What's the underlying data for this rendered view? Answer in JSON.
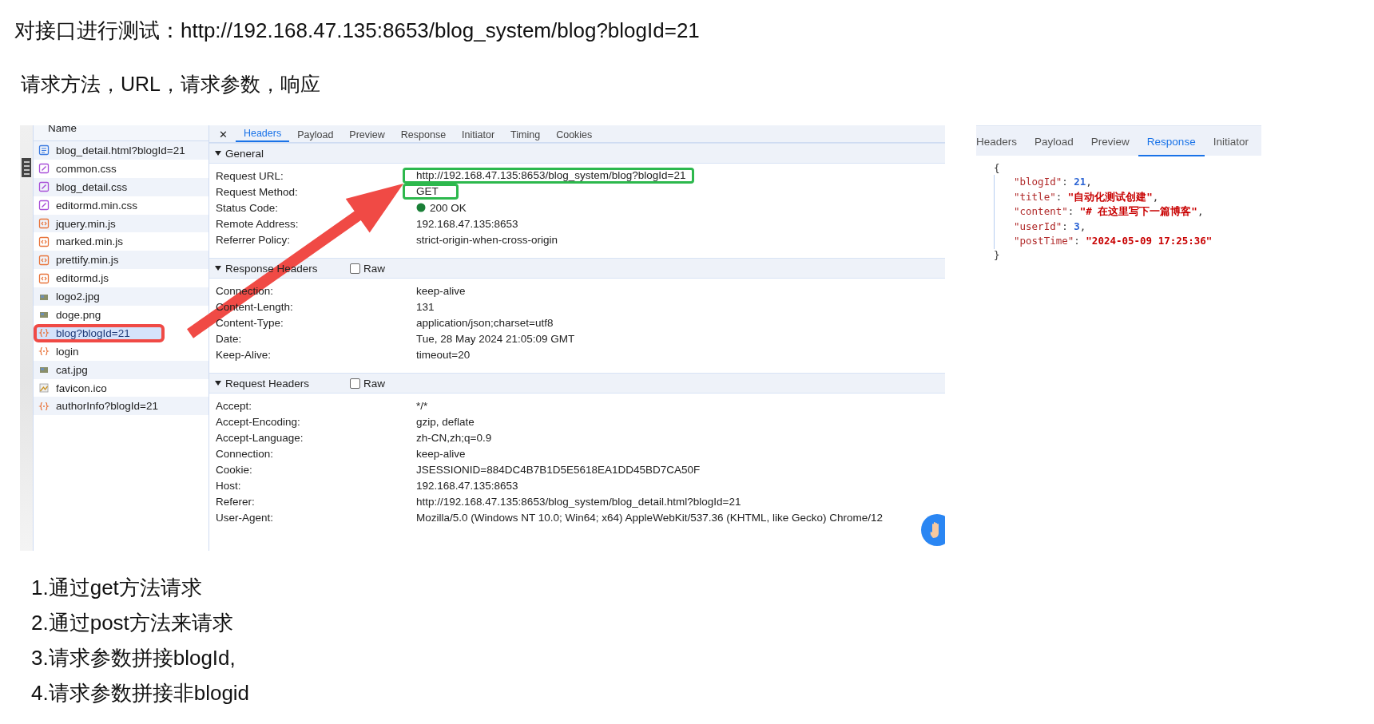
{
  "heading": "对接口进行测试：http://192.168.47.135:8653/blog_system/blog?blogId=21",
  "subheading": "请求方法，URL，请求参数，响应",
  "devtools": {
    "file_list": {
      "header": "Name",
      "items": [
        {
          "name": "blog_detail.html?blogId=21",
          "kind": "doc",
          "selected": false,
          "annotated": false
        },
        {
          "name": "common.css",
          "kind": "css",
          "selected": false,
          "annotated": false
        },
        {
          "name": "blog_detail.css",
          "kind": "css",
          "selected": false,
          "annotated": false
        },
        {
          "name": "editormd.min.css",
          "kind": "css",
          "selected": false,
          "annotated": false
        },
        {
          "name": "jquery.min.js",
          "kind": "js",
          "selected": false,
          "annotated": false
        },
        {
          "name": "marked.min.js",
          "kind": "js",
          "selected": false,
          "annotated": false
        },
        {
          "name": "prettify.min.js",
          "kind": "js",
          "selected": false,
          "annotated": false
        },
        {
          "name": "editormd.js",
          "kind": "js",
          "selected": false,
          "annotated": false
        },
        {
          "name": "logo2.jpg",
          "kind": "img",
          "selected": false,
          "annotated": false
        },
        {
          "name": "doge.png",
          "kind": "img",
          "selected": false,
          "annotated": false
        },
        {
          "name": "blog?blogId=21",
          "kind": "xhr",
          "selected": true,
          "annotated": true
        },
        {
          "name": "login",
          "kind": "xhr",
          "selected": false,
          "annotated": false
        },
        {
          "name": "cat.jpg",
          "kind": "img",
          "selected": false,
          "annotated": false
        },
        {
          "name": "favicon.ico",
          "kind": "ico",
          "selected": false,
          "annotated": false
        },
        {
          "name": "authorInfo?blogId=21",
          "kind": "xhr",
          "selected": false,
          "annotated": false
        }
      ]
    },
    "close": "✕",
    "tabs": [
      {
        "label": "Headers",
        "selected": true
      },
      {
        "label": "Payload",
        "selected": false
      },
      {
        "label": "Preview",
        "selected": false
      },
      {
        "label": "Response",
        "selected": false
      },
      {
        "label": "Initiator",
        "selected": false
      },
      {
        "label": "Timing",
        "selected": false
      },
      {
        "label": "Cookies",
        "selected": false
      }
    ],
    "sections": [
      {
        "title": "General",
        "expanded": true,
        "rows": [
          {
            "label": "Request URL:",
            "value": "http://192.168.47.135:8653/blog_system/blog?blogId=21",
            "annotated": true
          },
          {
            "label": "Request Method:",
            "value": "GET",
            "annotated": true
          },
          {
            "label": "Status Code:",
            "value": "200 OK",
            "annotated": false,
            "color": "#1a7f37"
          },
          {
            "label": "Remote Address:",
            "value": "192.168.47.135:8653",
            "annotated": false
          },
          {
            "label": "Referrer Policy:",
            "value": "strict-origin-when-cross-origin",
            "annotated": false
          }
        ]
      },
      {
        "title": "Response Headers",
        "expanded": true,
        "raw": {
          "label": "Raw",
          "checked": false
        },
        "rows": [
          {
            "label": "Connection:",
            "value": "keep-alive",
            "annotated": false
          },
          {
            "label": "Content-Length:",
            "value": "131",
            "annotated": false
          },
          {
            "label": "Content-Type:",
            "value": "application/json;charset=utf8",
            "annotated": false
          },
          {
            "label": "Date:",
            "value": "Tue, 28 May 2024 21:05:09 GMT",
            "annotated": false
          },
          {
            "label": "Keep-Alive:",
            "value": "timeout=20",
            "annotated": false
          }
        ]
      },
      {
        "title": "Request Headers",
        "expanded": true,
        "raw": {
          "label": "Raw",
          "checked": false
        },
        "rows": [
          {
            "label": "Accept:",
            "value": "*/*",
            "annotated": false
          },
          {
            "label": "Accept-Encoding:",
            "value": "gzip, deflate",
            "annotated": false
          },
          {
            "label": "Accept-Language:",
            "value": "zh-CN,zh;q=0.9",
            "annotated": false
          },
          {
            "label": "Connection:",
            "value": "keep-alive",
            "annotated": false
          },
          {
            "label": "Cookie:",
            "value": "JSESSIONID=884DC4B7B1D5E5618EA1DD45BD7CA50F",
            "annotated": false
          },
          {
            "label": "Host:",
            "value": "192.168.47.135:8653",
            "annotated": false
          },
          {
            "label": "Referer:",
            "value": "http://192.168.47.135:8653/blog_system/blog_detail.html?blogId=21",
            "annotated": false
          },
          {
            "label": "User-Agent:",
            "value": "Mozilla/5.0 (Windows NT 10.0; Win64; x64) AppleWebKit/537.36 (KHTML, like Gecko) Chrome/12",
            "annotated": false
          }
        ]
      }
    ]
  },
  "response_panel": {
    "tabs": [
      {
        "label": "Headers",
        "selected": false
      },
      {
        "label": "Payload",
        "selected": false
      },
      {
        "label": "Preview",
        "selected": false
      },
      {
        "label": "Response",
        "selected": true
      },
      {
        "label": "Initiator",
        "selected": false
      }
    ],
    "open_brace": "{",
    "lines": [
      {
        "key": "\"blogId\"",
        "sep": ": ",
        "value": "21",
        "color": "#2c64d4",
        "end": ","
      },
      {
        "key": "\"title\"",
        "sep": ": ",
        "value": "\"自动化测试创建\"",
        "color": "#c80000",
        "end": ","
      },
      {
        "key": "\"content\"",
        "sep": ": ",
        "value": "\"# 在这里写下一篇博客\"",
        "color": "#c80000",
        "end": ","
      },
      {
        "key": "\"userId\"",
        "sep": ": ",
        "value": "3",
        "color": "#2c64d4",
        "end": ","
      },
      {
        "key": "\"postTime\"",
        "sep": ": ",
        "value": "\"2024-05-09 17:25:36\"",
        "color": "#c80000"
      }
    ],
    "close_brace": "}"
  },
  "notes": [
    "1.通过get方法请求",
    "2.通过post方法来请求",
    "3.请求参数拼接blogId,",
    "4.请求参数拼接非blogid"
  ]
}
